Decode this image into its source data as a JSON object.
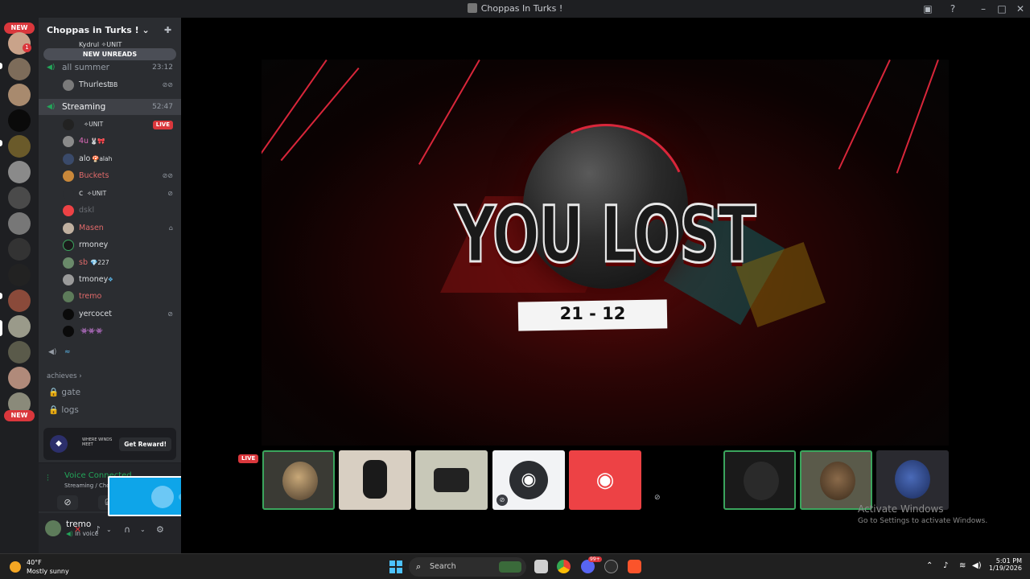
{
  "window": {
    "title": "Choppas In Turks !"
  },
  "servers": {
    "new_top": "NEW",
    "new_bottom": "NEW",
    "mention_count": "1"
  },
  "guild": {
    "name": "Choppas in Turks !",
    "chevron": "⌄",
    "new_unreads": "NEW UNREADS",
    "partial_top": "Kydrul ✧UNIT"
  },
  "voice_channels": [
    {
      "name": "all summer",
      "timer": "23:12"
    },
    {
      "name": "Streaming",
      "timer": "52:47"
    }
  ],
  "all_summer_users": [
    {
      "name": "Thurlest",
      "tag": "BB"
    }
  ],
  "streaming_users": [
    {
      "name": "",
      "tag": "✧UNIT",
      "live": "LIVE"
    },
    {
      "name": "4u",
      "tag": "🐰🎀"
    },
    {
      "name": "alo",
      "tag": "🍄alah"
    },
    {
      "name": "Buckets",
      "tag": ""
    },
    {
      "name": "c",
      "tag": "✧UNIT"
    },
    {
      "name": "dskl",
      "tag": ""
    },
    {
      "name": "Masen",
      "tag": ""
    },
    {
      "name": "rmoney",
      "tag": ""
    },
    {
      "name": "sb",
      "tag": "💎227"
    },
    {
      "name": "tmoney",
      "tag": ""
    },
    {
      "name": "tremo",
      "tag": ""
    },
    {
      "name": "yercocet",
      "tag": ""
    },
    {
      "name": "",
      "tag": "👾👾👾"
    }
  ],
  "category": {
    "name": "achieves"
  },
  "text_channels": [
    {
      "name": "gate"
    },
    {
      "name": "logs"
    }
  ],
  "promo": {
    "brand": "WHERE WINDS MEET",
    "button": "Get Reward!"
  },
  "voice": {
    "status": "Voice Connected",
    "location": "Streaming / Choppas In Turks !"
  },
  "user": {
    "name": "tremo",
    "status": "In voice"
  },
  "stream": {
    "headline": "YOU LOST",
    "score": "21 - 12"
  },
  "tiles": {
    "live": "LIVE"
  },
  "watermark": {
    "title": "Activate Windows",
    "subtitle": "Go to Settings to activate Windows."
  },
  "taskbar": {
    "weather_temp": "40°F",
    "weather_cond": "Mostly sunny",
    "search": "Search",
    "time": "5:01 PM",
    "date": "1/19/2026",
    "discord_badge": "99+"
  },
  "colors": {
    "accent": "#da373c",
    "green": "#23a559",
    "blurple": "#5865f2"
  }
}
